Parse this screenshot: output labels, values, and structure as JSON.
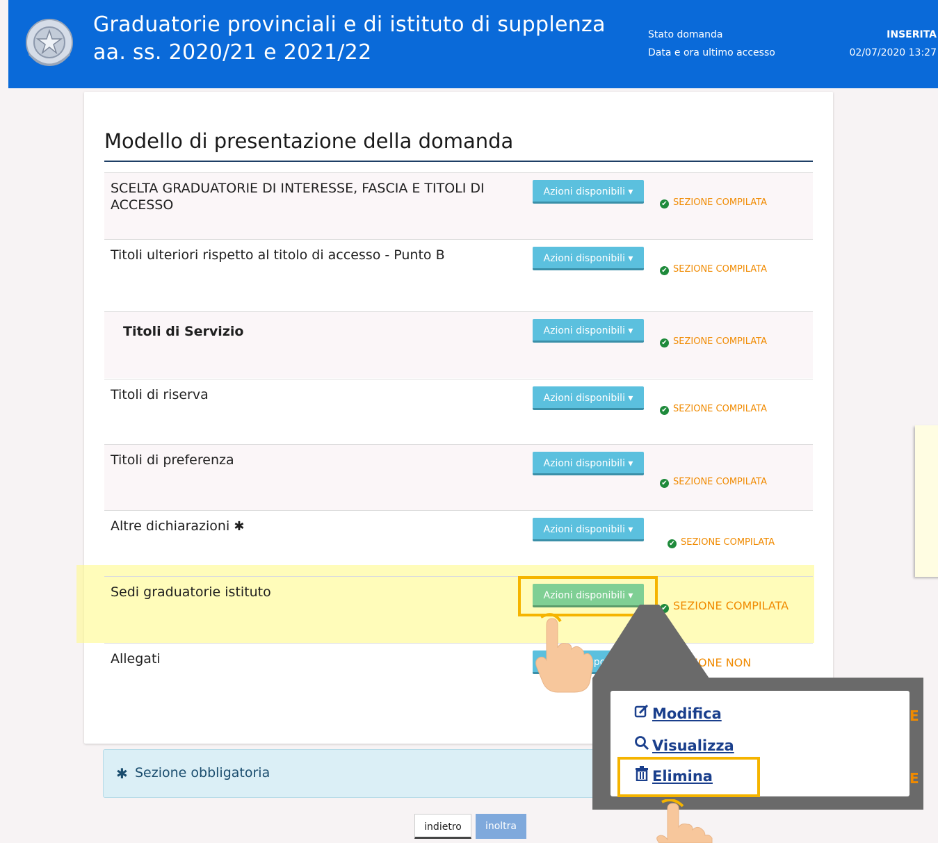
{
  "header": {
    "title_line1": "Graduatorie provinciali e di istituto di supplenza",
    "title_line2": "aa. ss. 2020/21 e 2021/22",
    "status_label": "Stato domanda",
    "status_value": "INSERITA",
    "last_access_label": "Data e ora ultimo accesso",
    "last_access_value": "02/07/2020 13:27",
    "logo_icon": "republic-emblem-icon"
  },
  "main": {
    "title": "Modello di presentazione della domanda",
    "actions_label": "Azioni disponibili",
    "dropdown_caret": "▾",
    "check_icon": "✔",
    "rows": [
      {
        "label": "SCELTA GRADUATORIE DI INTERESSE, FASCIA E TITOLI DI ACCESSO",
        "status": "SEZIONE COMPILATA"
      },
      {
        "label": "Titoli ulteriori rispetto al titolo di accesso - Punto B",
        "status": "SEZIONE COMPILATA"
      },
      {
        "label": "Titoli di Servizio",
        "status": "SEZIONE COMPILATA"
      },
      {
        "label": "Titoli di riserva",
        "status": "SEZIONE COMPILATA"
      },
      {
        "label": "Titoli di preferenza",
        "status": "SEZIONE COMPILATA"
      },
      {
        "label": "Altre dichiarazioni",
        "status": "SEZIONE COMPILATA",
        "mandatory_mark": "✱"
      },
      {
        "label": "Sedi graduatorie istituto",
        "status": "SEZIONE COMPILATA"
      },
      {
        "label": "Allegati",
        "status": "SEZIONE NON",
        "actions_partial": "sponibili"
      }
    ]
  },
  "note": {
    "icon": "✱",
    "text": "Sezione obbligatoria"
  },
  "footer": {
    "back": "indietro",
    "send": "inoltra"
  },
  "menu": {
    "items": [
      {
        "label": "Modifica",
        "icon": "edit-icon"
      },
      {
        "label": "Visualizza",
        "icon": "search-icon"
      },
      {
        "label": "Elimina",
        "icon": "trash-icon"
      }
    ]
  },
  "colors": {
    "header": "#0a6ad9",
    "status": "#f08a00",
    "check": "#1e8a3b",
    "button": "#5bc0de",
    "highlight": "#f5b400"
  }
}
